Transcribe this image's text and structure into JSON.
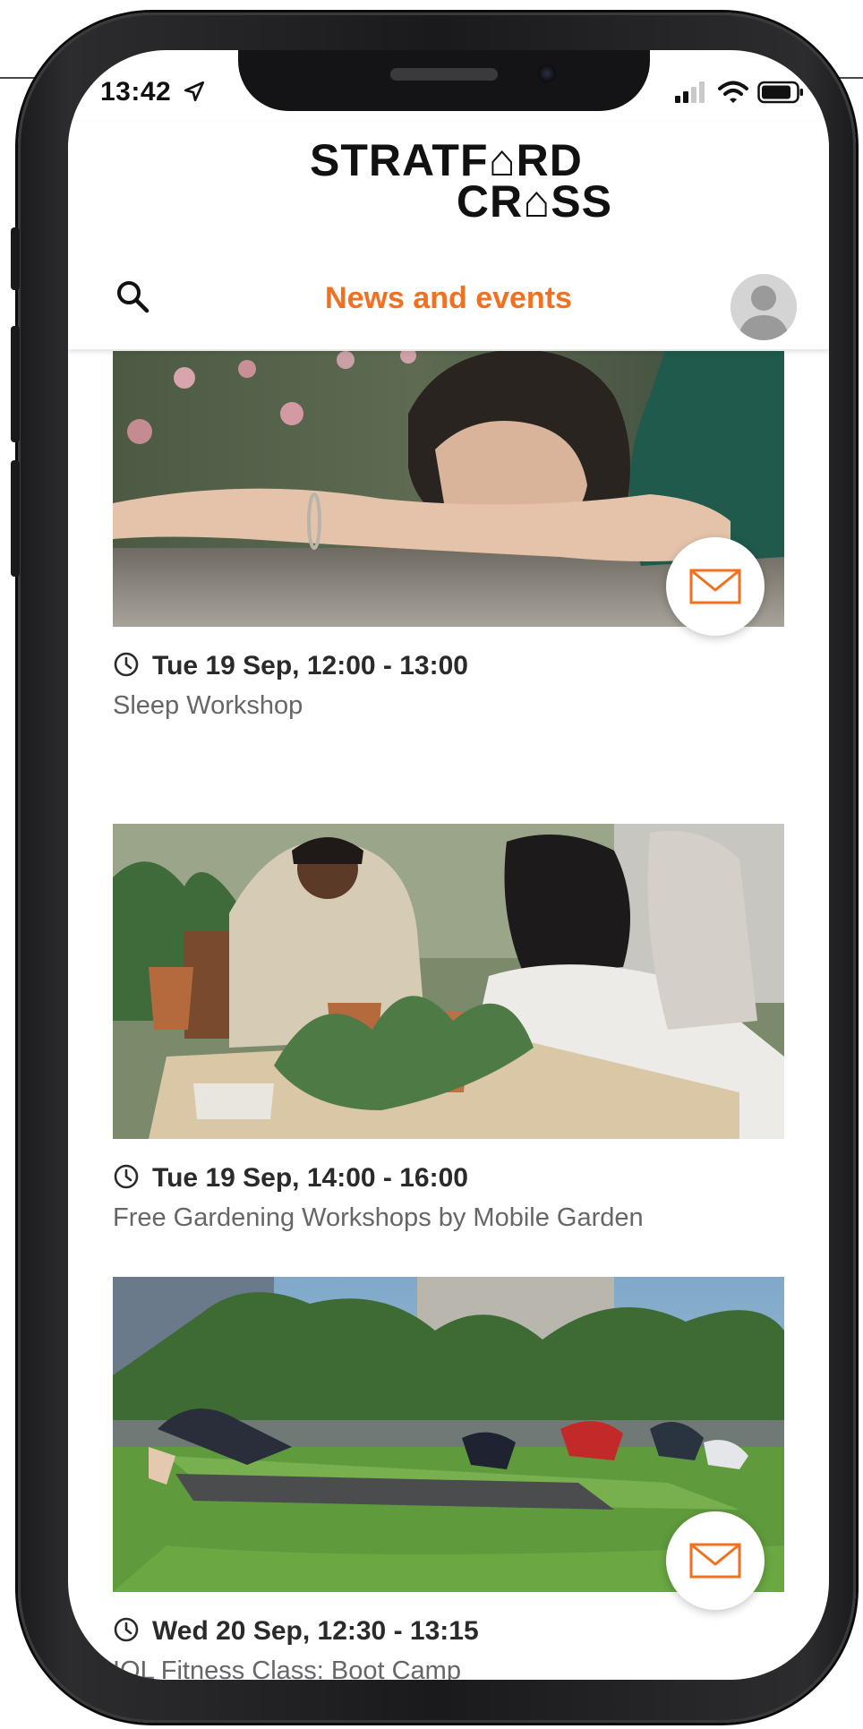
{
  "status_bar": {
    "time": "13:42"
  },
  "header": {
    "logo_line1": "STRATF⌂RD",
    "logo_line2": "CR⌂SS",
    "title": "News and events"
  },
  "events": [
    {
      "datetime": "Tue 19 Sep, 12:00 - 13:00",
      "title": "Sleep Workshop",
      "has_mail": true
    },
    {
      "datetime": "Tue 19 Sep, 14:00 - 16:00",
      "title": "Free Gardening Workshops by Mobile Garden",
      "has_mail": false
    },
    {
      "datetime": "Wed 20 Sep, 12:30 - 13:15",
      "title": "IQL Fitness Class: Boot Camp",
      "has_mail": true
    }
  ],
  "colors": {
    "accent": "#f37021",
    "title_text": "#2a2a2a",
    "subtitle_text": "#666666"
  },
  "icons": {
    "search": "search-icon",
    "clock": "clock-icon",
    "mail": "mail-icon",
    "avatar": "user-avatar-icon",
    "location": "location-arrow-icon",
    "signal": "signal-icon",
    "wifi": "wifi-icon",
    "battery": "battery-icon"
  }
}
